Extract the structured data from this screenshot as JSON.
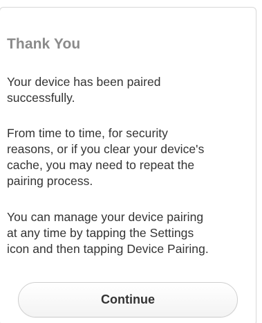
{
  "dialog": {
    "title": "Thank You",
    "paragraphs": [
      "Your device has been paired\nsuccessfully.",
      "From time to time, for security\nreasons, or if you clear your device's\ncache, you may need to repeat the\npairing process.",
      "You can manage your device pairing\nat any time by tapping the Settings\nicon and then tapping Device Pairing."
    ],
    "continue_label": "Continue"
  }
}
